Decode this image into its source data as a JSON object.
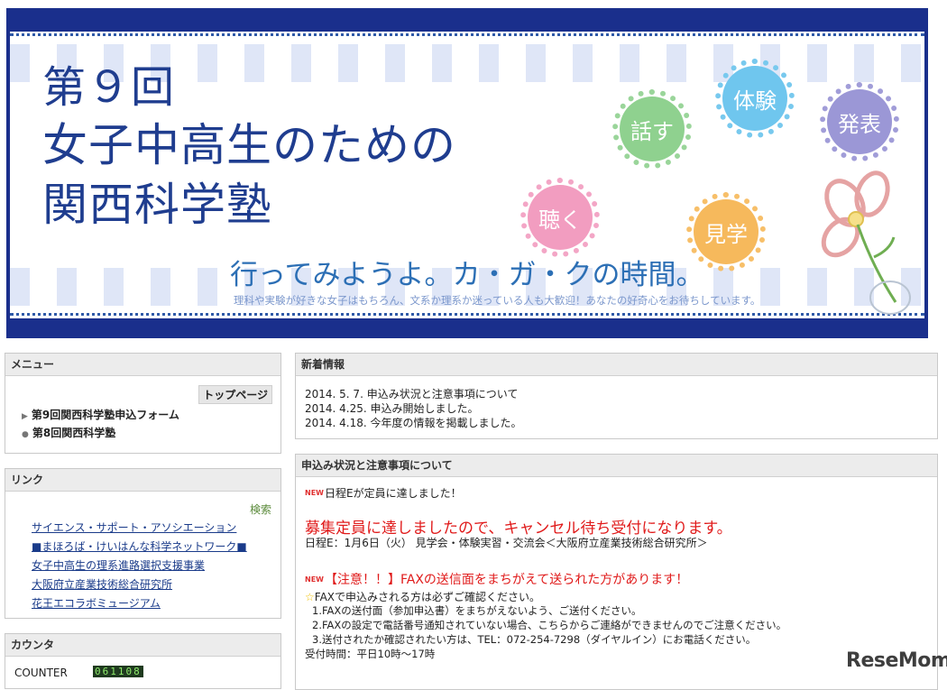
{
  "banner": {
    "title_line1": "第９回",
    "title_line2": "女子中高生のための",
    "title_line3": "関西科学塾",
    "slogan": "行ってみようよ。カ・ガ・クの時間。",
    "subline": "理科や実験が好きな女子はもちろん、文系か理系か迷っている人も大歓迎！あなたの好奇心をお待ちしています。",
    "bubbles": {
      "hanasu": "話す",
      "taiken": "体験",
      "happyo": "発表",
      "kiku": "聴く",
      "kengaku": "見学"
    }
  },
  "menu": {
    "title": "メニュー",
    "top_page": "トップページ",
    "items": [
      "第9回関西科学塾申込フォーム",
      "第8回関西科学塾"
    ]
  },
  "links": {
    "title": "リンク",
    "search": "検索",
    "items": [
      "サイエンス・サポート・アソシエーション",
      "■まほろば・けいはんな科学ネットワーク■",
      "女子中高生の理系進路選択支援事業",
      "大阪府立産業技術総合研究所",
      "花王エコラボミュージアム"
    ]
  },
  "counter": {
    "title": "カウンタ",
    "label": "COUNTER",
    "value": "061108"
  },
  "news": {
    "title": "新着情報",
    "items": [
      "2014. 5. 7.  申込み状況と注意事項について",
      "2014. 4.25.  申込み開始しました。",
      "2014. 4.18.  今年度の情報を掲載しました。"
    ]
  },
  "notice": {
    "title": "申込み状況と注意事項について",
    "new_badge": "NEW",
    "line1": "日程Eが定員に達しました！",
    "red_big": "募集定員に達しましたので、キャンセル待ち受付になります。",
    "schedule": "日程E：1月6日（火） 見学会・体験実習・交流会＜大阪府立産業技術総合研究所＞",
    "red_mid": "【注意！！】FAXの送信面をまちがえて送られた方があります！",
    "star": "☆",
    "fax_intro": "FAXで申込みされる方は必ずご確認ください。",
    "fax_items": [
      "1.FAXの送付面（参加申込書）をまちがえないよう、ご送付ください。",
      "2.FAXの設定で電話番号通知されていない場合、こちらからご連絡ができませんのでご注意ください。",
      "3.送付されたか確認されたい方は、TEL：072-254-7298（ダイヤルイン）にお電話ください。"
    ],
    "hours": "受付時間：平日10時～17時"
  },
  "watermark": "ReseMom"
}
